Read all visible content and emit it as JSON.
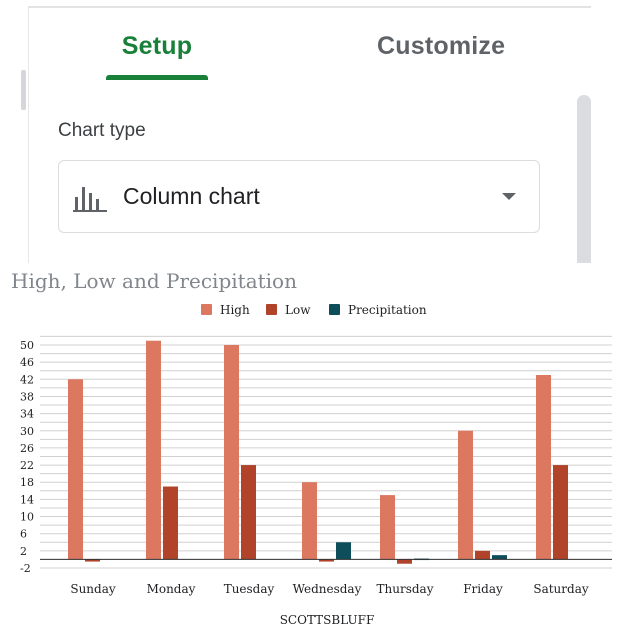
{
  "editor": {
    "tabs": [
      {
        "label": "Setup",
        "active": true
      },
      {
        "label": "Customize",
        "active": false
      }
    ],
    "chart_type_label": "Chart type",
    "chart_type_value": "Column chart",
    "chart_type_icon": "column-chart-icon",
    "accent_color": "#188038"
  },
  "chart_data": {
    "type": "bar",
    "title": "High, Low and Precipitation",
    "xlabel": "SCOTTSBLUFF",
    "ylabel": "",
    "ylim": [
      -2,
      52
    ],
    "yticks": [
      -2,
      2,
      6,
      10,
      14,
      18,
      22,
      26,
      30,
      34,
      38,
      42,
      46,
      50
    ],
    "grid": true,
    "legend": "top",
    "categories": [
      "Sunday",
      "Monday",
      "Tuesday",
      "Wednesday",
      "Thursday",
      "Friday",
      "Saturday"
    ],
    "series": [
      {
        "name": "High",
        "color": "#dc7760",
        "values": [
          42,
          51,
          50,
          18,
          15,
          30,
          43
        ]
      },
      {
        "name": "Low",
        "color": "#b0432a",
        "values": [
          -0.5,
          17,
          22,
          -0.5,
          -1,
          2,
          22
        ]
      },
      {
        "name": "Precipitation",
        "color": "#0e4d5a",
        "values": [
          0,
          0,
          0,
          4,
          0.2,
          1,
          0
        ]
      }
    ]
  }
}
